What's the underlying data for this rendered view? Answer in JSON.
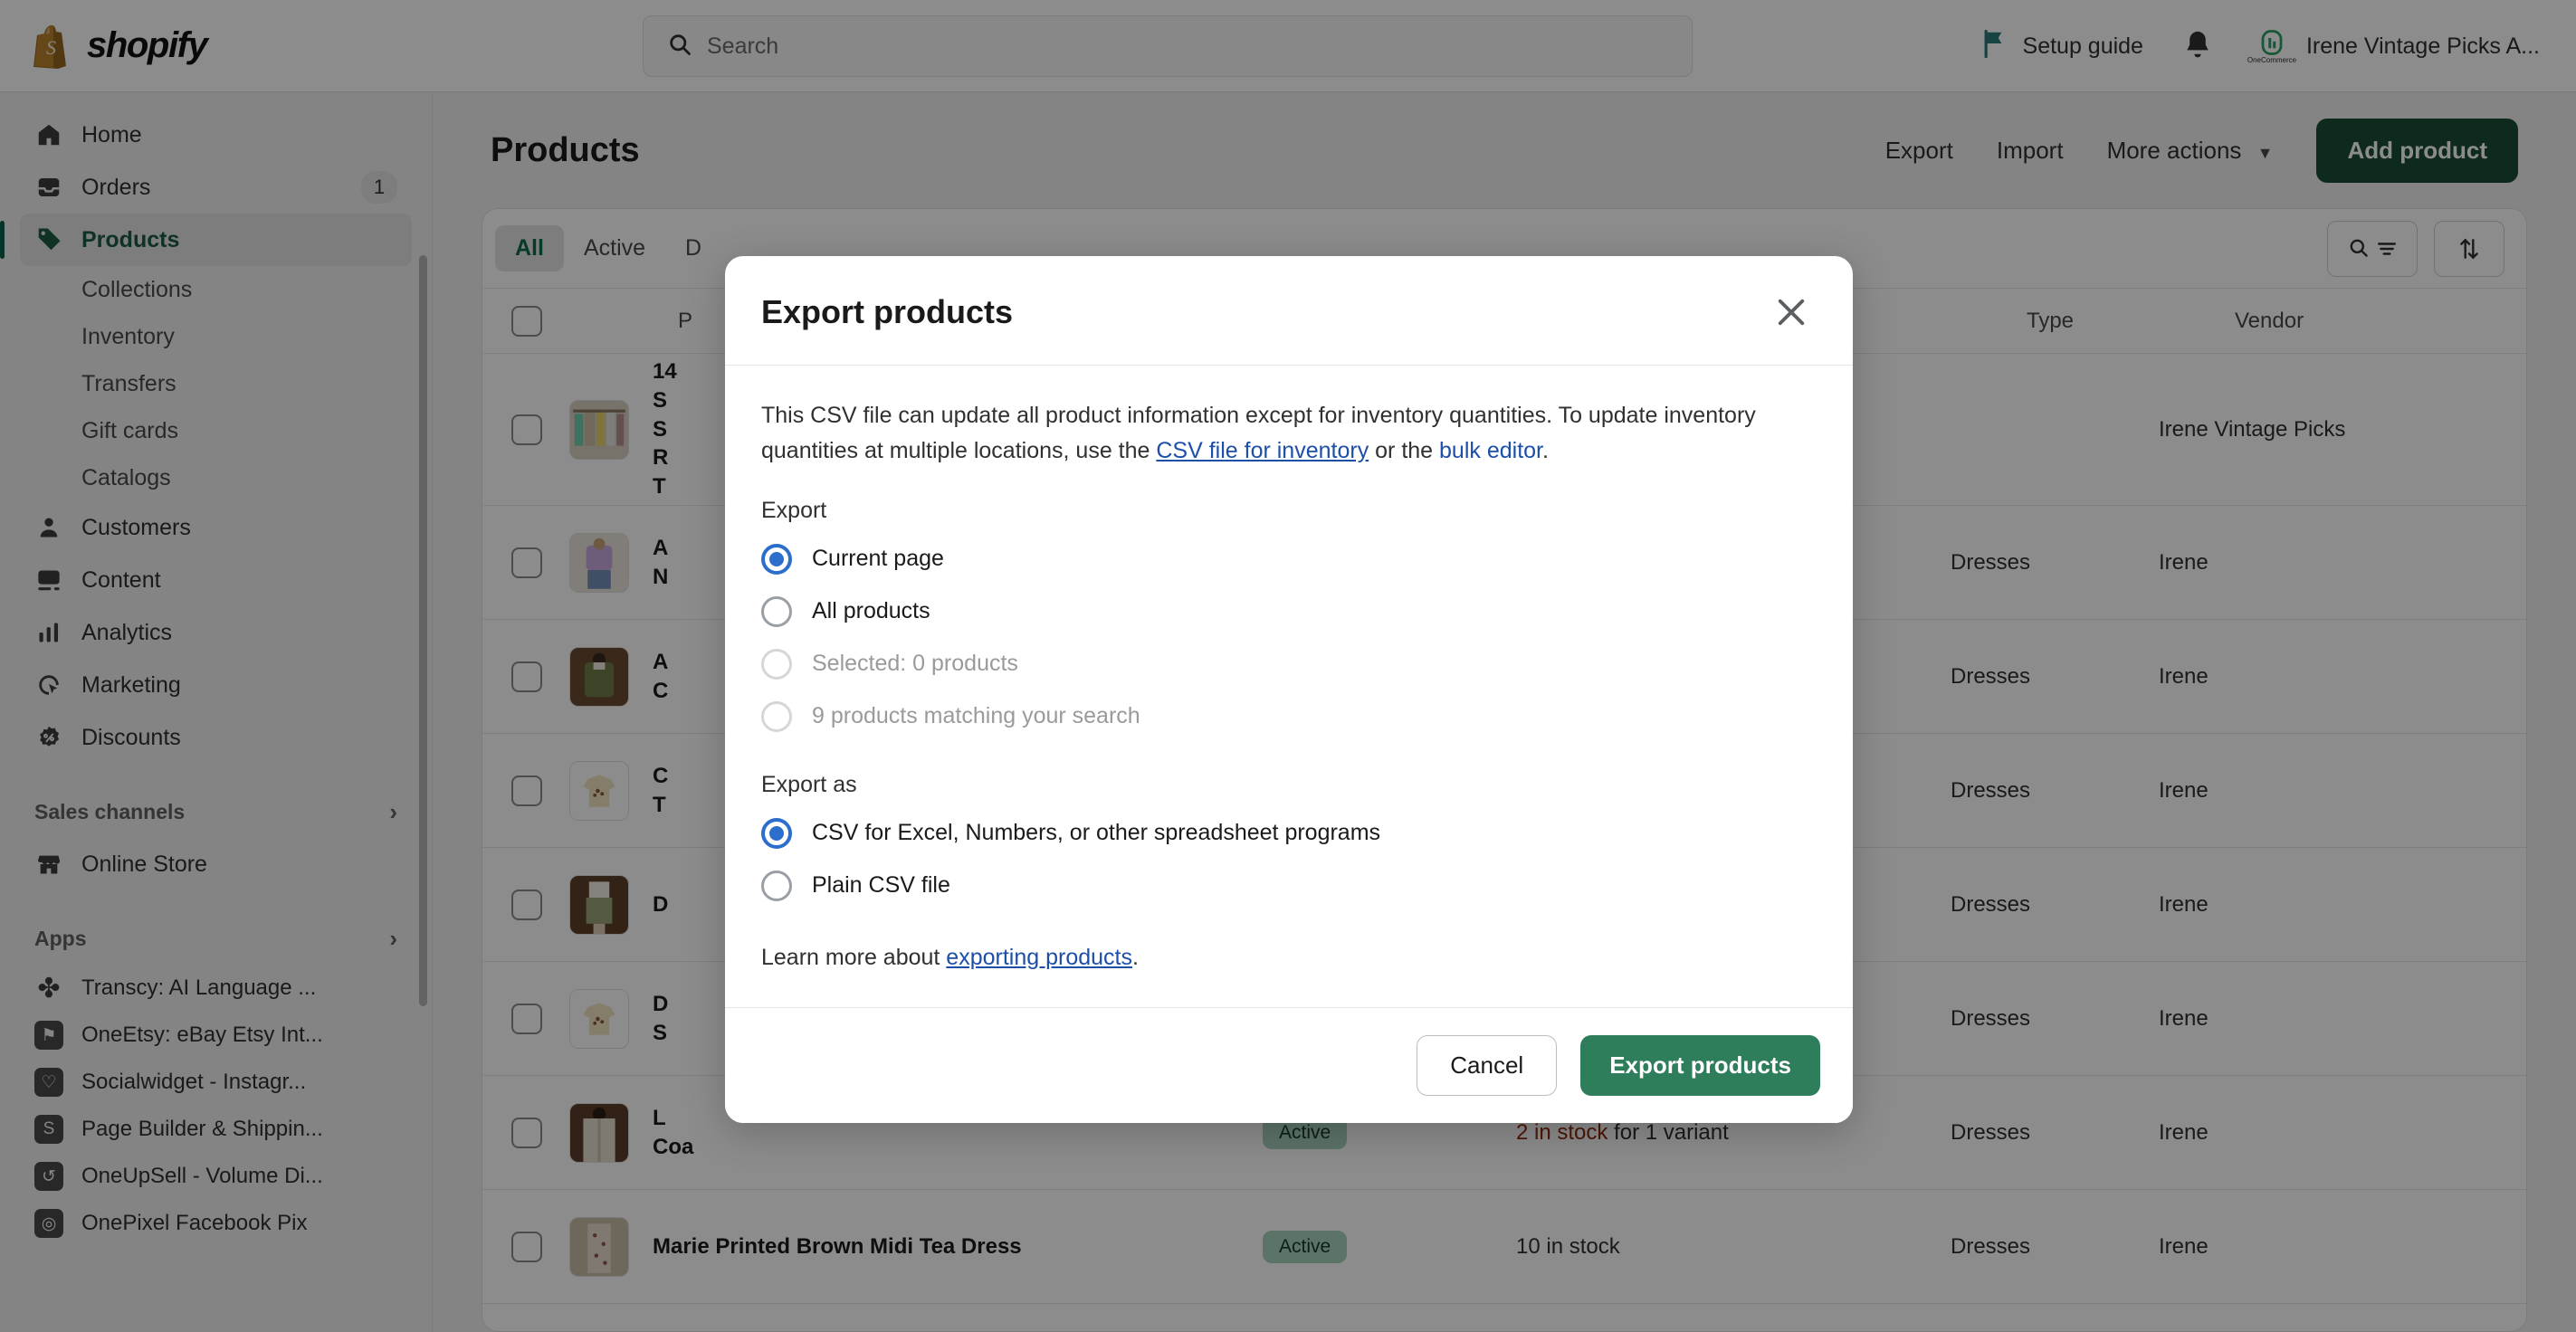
{
  "topbar": {
    "brand_name": "shopify",
    "search_placeholder": "Search",
    "search_icon": "search-icon",
    "setup_guide_label": "Setup guide",
    "setup_guide_icon": "flag-icon",
    "notifications_icon": "bell-icon",
    "account_name": "Irene Vintage Picks A...",
    "account_logo_caption": "OneCommerce"
  },
  "sidebar": {
    "primary": [
      {
        "label": "Home",
        "icon": "home-icon",
        "active": false,
        "badge": ""
      },
      {
        "label": "Orders",
        "icon": "orders-inbox-icon",
        "active": false,
        "badge": "1"
      },
      {
        "label": "Products",
        "icon": "tag-icon",
        "active": true,
        "badge": ""
      }
    ],
    "product_subitems": [
      {
        "label": "Collections"
      },
      {
        "label": "Inventory"
      },
      {
        "label": "Transfers"
      },
      {
        "label": "Gift cards"
      },
      {
        "label": "Catalogs"
      }
    ],
    "secondary": [
      {
        "label": "Customers",
        "icon": "person-icon"
      },
      {
        "label": "Content",
        "icon": "image-icon"
      },
      {
        "label": "Analytics",
        "icon": "bar-chart-icon"
      },
      {
        "label": "Marketing",
        "icon": "target-cursor-icon"
      },
      {
        "label": "Discounts",
        "icon": "discount-badge-icon"
      }
    ],
    "sales_channels": {
      "label": "Sales channels",
      "chevron_icon": "chevron-right-icon",
      "items": [
        {
          "label": "Online Store",
          "icon": "storefront-icon"
        }
      ]
    },
    "apps": {
      "label": "Apps",
      "chevron_icon": "chevron-right-icon",
      "items": [
        {
          "label": "Transcy: AI Language ...",
          "icon": "transcy-app-icon",
          "glyph": "✤"
        },
        {
          "label": "OneEtsy: eBay Etsy Int...",
          "icon": "oneetsy-app-icon",
          "glyph": "⚑"
        },
        {
          "label": "Socialwidget - Instagr...",
          "icon": "socialwidget-app-icon",
          "glyph": "♡"
        },
        {
          "label": "Page Builder & Shippin...",
          "icon": "pagebuilder-app-icon",
          "glyph": "S"
        },
        {
          "label": "OneUpSell - Volume Di...",
          "icon": "oneupsell-app-icon",
          "glyph": "↺"
        },
        {
          "label": "OnePixel Facebook Pix",
          "icon": "onepixel-app-icon",
          "glyph": "◎"
        }
      ]
    }
  },
  "page": {
    "title": "Products",
    "actions": {
      "export_label": "Export",
      "import_label": "Import",
      "more_actions_label": "More actions",
      "more_actions_caret_icon": "chevron-down-icon",
      "add_product_label": "Add product"
    }
  },
  "table": {
    "tabs": [
      {
        "label": "All",
        "active": true
      },
      {
        "label": "Active",
        "active": false
      },
      {
        "label": "D",
        "active": false
      }
    ],
    "tools": [
      {
        "icon": "search-filter-icon"
      },
      {
        "icon": "sort-arrows-icon"
      }
    ],
    "columns": {
      "product": "P",
      "status": "",
      "inventory": "",
      "type": "Type",
      "vendor": "Vendor"
    },
    "rows": [
      {
        "name": "14\nS\nS\nR\nT",
        "status": "",
        "inventory": "",
        "type": "",
        "vendor": "Irene Vintage Picks",
        "thumb": "rack-of-dresses"
      },
      {
        "name": "A\nN",
        "status": "",
        "inventory": "",
        "type": "Dresses",
        "vendor": "Irene",
        "thumb": "purple-blouse"
      },
      {
        "name": "A\nC",
        "status": "",
        "inventory": "",
        "type": "Dresses",
        "vendor": "Irene",
        "thumb": "green-cardigan"
      },
      {
        "name": "C\nT",
        "status": "",
        "inventory": "",
        "type": "Dresses",
        "vendor": "Irene",
        "thumb": "cream-tee"
      },
      {
        "name": "D",
        "status": "",
        "inventory": "",
        "type": "Dresses",
        "vendor": "Irene",
        "thumb": "green-shorts"
      },
      {
        "name": "D\nS",
        "status": "",
        "inventory": "",
        "type": "Dresses",
        "vendor": "Irene",
        "thumb": "cream-tee-2"
      },
      {
        "name": "L\nCoa",
        "status": "Active",
        "inventory_prefix": "2 in stock",
        "inventory_suffix": " for 1 variant",
        "type": "Dresses",
        "vendor": "Irene",
        "thumb": "beige-coat",
        "low_stock": true
      },
      {
        "name": "Marie Printed Brown Midi Tea Dress",
        "status": "Active",
        "inventory_prefix": "10 in stock",
        "inventory_suffix": "",
        "type": "Dresses",
        "vendor": "Irene",
        "thumb": "printed-tea-dress",
        "low_stock": false
      }
    ]
  },
  "modal": {
    "title": "Export products",
    "close_icon": "close-icon",
    "description_part1": "This CSV file can update all product information except for inventory quantities. To update inventory quantities at multiple locations, use the ",
    "link_csv_inventory": "CSV file for inventory",
    "description_part2": " or the ",
    "link_bulk_editor": "bulk editor",
    "description_part3": ".",
    "export_group_label": "Export",
    "export_options": [
      {
        "label": "Current page",
        "checked": true,
        "disabled": false
      },
      {
        "label": "All products",
        "checked": false,
        "disabled": false
      },
      {
        "label": "Selected: 0 products",
        "checked": false,
        "disabled": true
      },
      {
        "label": "9 products matching your search",
        "checked": false,
        "disabled": true
      }
    ],
    "export_as_group_label": "Export as",
    "export_as_options": [
      {
        "label": "CSV for Excel, Numbers, or other spreadsheet programs",
        "checked": true,
        "disabled": false
      },
      {
        "label": "Plain CSV file",
        "checked": false,
        "disabled": false
      }
    ],
    "learn_more_prefix": "Learn more about ",
    "learn_more_link": "exporting products",
    "learn_more_suffix": ".",
    "cancel_label": "Cancel",
    "submit_label": "Export products"
  },
  "colors": {
    "shopify_green": "#1a4d35",
    "accent_green": "#2e7d5b",
    "radio_blue": "#2c6ecb",
    "link_blue": "#1c4fa8",
    "badge_green": "#a8d2bd",
    "low_stock_red": "#8e2a0b"
  }
}
